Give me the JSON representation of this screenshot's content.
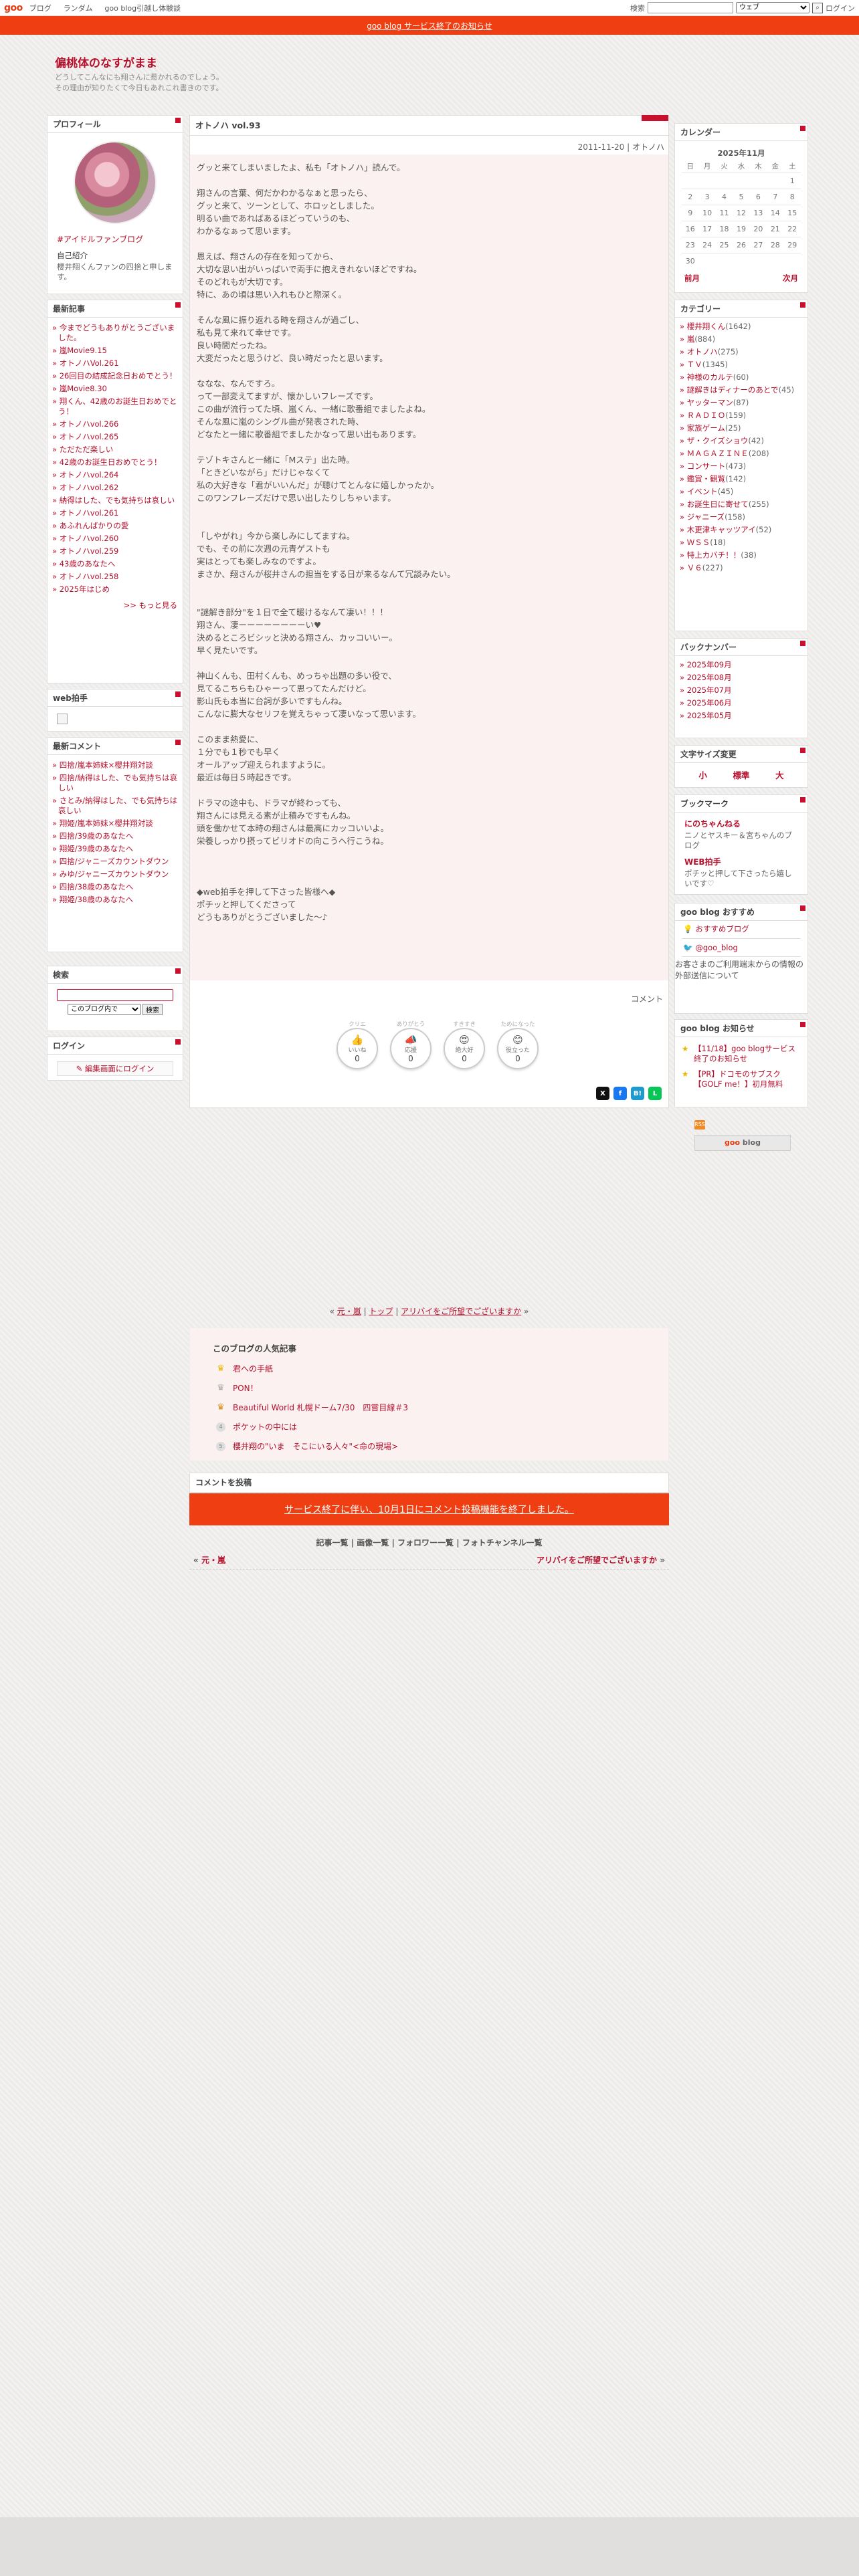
{
  "topbar": {
    "logo": "goo",
    "nav": [
      "ブログ",
      "ランダム",
      "goo blog引越し体験談"
    ],
    "search_label": "検索",
    "search_select": "ウェブ",
    "login": "ログイン"
  },
  "notice": "goo blog サービス終了のお知らせ",
  "header": {
    "title": "偏桃体のなすがまま",
    "desc1": "どうしてこんなにも翔さんに惹かれるのでしょう。",
    "desc2": "その理由が知りたくて今日もあれこれ書きのです。"
  },
  "profile": {
    "title": "プロフィール",
    "category": "#アイドルファンブログ",
    "label": "自己紹介",
    "text": "櫻井翔くんファンの四捨と申します。"
  },
  "recent_articles": {
    "title": "最新記事",
    "items": [
      "今までどうもありがとうございました。",
      "嵐Movie9.15",
      "オトノハVol.261",
      "26回目の結成記念日おめでとう！",
      "嵐Movie8.30",
      "翔くん、42歳のお誕生日おめでとう！",
      "オトノハvol.266",
      "オトノハvol.265",
      "ただただ楽しい",
      "42歳のお誕生日おめでとう！",
      "オトノハvol.264",
      "オトノハvol.262",
      "納得はした、でも気持ちは哀しい",
      "オトノハvol.261",
      "あふれんばかりの愛",
      "オトノハvol.260",
      "オトノハvol.259",
      "43歳のあなたへ",
      "オトノハvol.258",
      "2025年はじめ"
    ],
    "more": ">> もっと見る"
  },
  "webclap": {
    "title": "web拍手"
  },
  "recent_comments": {
    "title": "最新コメント",
    "items": [
      "四捨/嵐本姉妹×櫻井翔対談",
      "四捨/納得はした、でも気持ちは哀しい",
      "さとみ/納得はした、でも気持ちは哀しい",
      "翔姫/嵐本姉妹×櫻井翔対談",
      "四捨/39歳のあなたへ",
      "翔姫/39歳のあなたへ",
      "四捨/ジャニーズカウントダウン",
      "みゆ/ジャニーズカウントダウン",
      "四捨/38歳のあなたへ",
      "翔姫/38歳のあなたへ"
    ]
  },
  "search_box": {
    "title": "検索",
    "scope": "このブログ内で",
    "button": "検索"
  },
  "login_box": {
    "title": "ログイン",
    "button": "編集画面にログイン"
  },
  "article": {
    "title": "オトノハ vol.93",
    "meta_date": "2011-11-20",
    "meta_sep": " | ",
    "meta_cat": "オトノハ",
    "body": "グッと来てしまいましたよ、私も「オトノハ」読んで。\n\n翔さんの言葉、何だかわかるなぁと思ったら、\nグッと来て、ツーンとして、ホロッとしました。\n明るい曲であればあるほどっていうのも、\nわかるなぁって思います。\n\n恩えば、翔さんの存在を知ってから、\n大切な思い出がいっぱいで両手に抱えきれないほどですね。\nそのどれもが大切です。\n特に、あの頃は思い入れもひと際深く。\n\nそんな風に振り返れる時を翔さんが過ごし、\n私も見て来れて幸せです。\n良い時間だったね。\n大変だったと思うけど、良い時だったと思います。\n\nななな、なんですろ。\nって一部変えてますが、懐かしいフレーズです。\nこの曲が流行ってた頃、嵐くん、一緒に歌番組でましたよね。\nそんな風に嵐のシングル曲が発表された時、\nどなたと一緒に歌番組でましたかなって思い出もあります。\n\nテゾトキさんと一緒に「Mステ」出た時。\n「ときどいながら」だけじゃなくて\n私の大好きな「君がいいんだ」が聴けてとんなに嬉しかったか。\nこのワンフレーズだけで思い出したりしちゃいます。\n\n\n「しやがれ」今から楽しみにしてますね。\nでも、その前に次週の元青ゲストも\n実はとっても楽しみなのですよ。\nまさか、翔さんが桜井さんの担当をする日が来るなんて冗談みたい。\n\n\n\"謎解き部分\"を１日で全て暖けるなんて凄い！！！\n翔さん、凄ーーーーーーーーい♥\n決めるところビシッと決める翔さん、カッコいいー。\n早く見たいです。\n\n神山くんも、田村くんも、めっちゃ出題の多い役で、\n見てるこちらもひゃーって思ってたんだけど。\n影山氏も本当に台詞が多いですもんね。\nこんなに膨大なセリフを覚えちゃって凄いなって思います。\n\nこのまま熱愛に、\n１分でも１秒でも早く\nオールアップ迎えられますように。\n最近は毎日５時起きです。\n\nドラマの途中も、ドラマが終わっても、\n翔さんには見える素が止積みですもんね。\n頭を働かせて本時の翔さんは最高にカッコいいよ。\n栄養しっかり摂ってビリオドの向こうへ行こうね。\n\n\n\n◆web拍手を押して下さった皆様へ◆\nポチッと押してくださって\nどうもありがとうございました～♪"
  },
  "comment_link": "コメント",
  "reactions": [
    {
      "tag": "クリエ",
      "emoji": "👍",
      "name": "いいね",
      "count": "0"
    },
    {
      "tag": "ありがとう",
      "emoji": "📣",
      "name": "応援",
      "count": "0"
    },
    {
      "tag": "すきすき",
      "emoji": "😍",
      "name": "絶大好",
      "count": "0"
    },
    {
      "tag": "ためになった",
      "emoji": "😊",
      "name": "役立った",
      "count": "0"
    }
  ],
  "share": [
    "X",
    "f",
    "B!",
    "L"
  ],
  "calendar": {
    "title": "カレンダー",
    "caption": "2025年11月",
    "days": [
      "日",
      "月",
      "火",
      "水",
      "木",
      "金",
      "土"
    ],
    "weeks": [
      [
        "",
        "",
        "",
        "",
        "",
        "",
        "1"
      ],
      [
        "2",
        "3",
        "4",
        "5",
        "6",
        "7",
        "8"
      ],
      [
        "9",
        "10",
        "11",
        "12",
        "13",
        "14",
        "15"
      ],
      [
        "16",
        "17",
        "18",
        "19",
        "20",
        "21",
        "22"
      ],
      [
        "23",
        "24",
        "25",
        "26",
        "27",
        "28",
        "29"
      ],
      [
        "30",
        "",
        "",
        "",
        "",
        "",
        ""
      ]
    ],
    "prev": "前月",
    "next": "次月"
  },
  "categories": {
    "title": "カテゴリー",
    "items": [
      {
        "name": "櫻井翔くん",
        "count": "(1642)"
      },
      {
        "name": "嵐",
        "count": "(884)"
      },
      {
        "name": "オトノハ",
        "count": "(275)"
      },
      {
        "name": "ＴＶ",
        "count": "(1345)"
      },
      {
        "name": "神様のカルテ",
        "count": "(60)"
      },
      {
        "name": "謎解きはディナーのあとで",
        "count": "(45)"
      },
      {
        "name": "ヤッターマン",
        "count": "(87)"
      },
      {
        "name": "ＲＡＤＩＯ",
        "count": "(159)"
      },
      {
        "name": "家族ゲーム",
        "count": "(25)"
      },
      {
        "name": "ザ・クイズショウ",
        "count": "(42)"
      },
      {
        "name": "ＭＡＧＡＺＩＮＥ",
        "count": "(208)"
      },
      {
        "name": "コンサート",
        "count": "(473)"
      },
      {
        "name": "鑑賞・観覧",
        "count": "(142)"
      },
      {
        "name": "イベント",
        "count": "(45)"
      },
      {
        "name": "お誕生日に寄せて",
        "count": "(255)"
      },
      {
        "name": "ジャニーズ",
        "count": "(158)"
      },
      {
        "name": "木更津キャッツアイ",
        "count": "(52)"
      },
      {
        "name": "ＷＳＳ",
        "count": "(18)"
      },
      {
        "name": "特上カバチ！！",
        "count": "(38)"
      },
      {
        "name": "Ｖ６",
        "count": "(227)"
      }
    ]
  },
  "backnumber": {
    "title": "バックナンバー",
    "items": [
      "2025年09月",
      "2025年08月",
      "2025年07月",
      "2025年06月",
      "2025年05月"
    ]
  },
  "fontsize": {
    "title": "文字サイズ変更",
    "small": "小",
    "medium": "標準",
    "large": "大"
  },
  "bookmark": {
    "title": "ブックマーク",
    "b1_name": "にのちゃんねる",
    "b1_desc": "ニノとヤスキー＆宮ちゃんのブログ",
    "b2_name": "WEB拍手",
    "b2_desc": "ポチッと押して下さったら嬉しいです♡"
  },
  "recommend": {
    "title": "goo blog おすすめ",
    "item1": "おすすめブログ",
    "item2": "@goo_blog",
    "warn": "お客さまのご利用端末からの情報の外部送信について"
  },
  "gnews": {
    "title": "goo blog お知らせ",
    "items": [
      "【11/18】goo blogサービス終了のお知らせ",
      "【PR】ドコモのサブスク【GOLF me！】初月無料"
    ]
  },
  "rss": "RSS",
  "goo_blog_badge_goo": "goo",
  "goo_blog_badge_rest": " blog",
  "bottom_nav": {
    "prev": "元・嵐",
    "top": "トップ",
    "next": "アリバイをご所望でございますか"
  },
  "popular": {
    "title": "このブログの人気記事",
    "items": [
      {
        "badge": "gold",
        "icon": "♛",
        "text": "君への手紙"
      },
      {
        "badge": "silver",
        "icon": "♛",
        "text": "PON！"
      },
      {
        "badge": "bronze",
        "icon": "♛",
        "text": "Beautiful World 札幌ドーム7/30　四嘗目線＃3"
      },
      {
        "badge": "dot",
        "icon": "4",
        "text": "ポケットの中には"
      },
      {
        "badge": "dot",
        "icon": "5",
        "text": "櫻井翔の\"いま　そこにいる人々\"<命の現場>"
      }
    ]
  },
  "comment_post_title": "コメントを投稿",
  "comment_closed": "サービス終了に伴い、10月1日にコメント投稿機能を終了しました。",
  "footer_links": [
    "記事一覧",
    "画像一覧",
    "フォロワー一覧",
    "フォトチャンネル一覧"
  ],
  "prevnext": {
    "prev": "元・嵐",
    "next": "アリバイをご所望でございますか"
  },
  "colors": {
    "accent": "#c8102e",
    "notice_bg": "#ef3e12",
    "link": "#b5102c"
  }
}
